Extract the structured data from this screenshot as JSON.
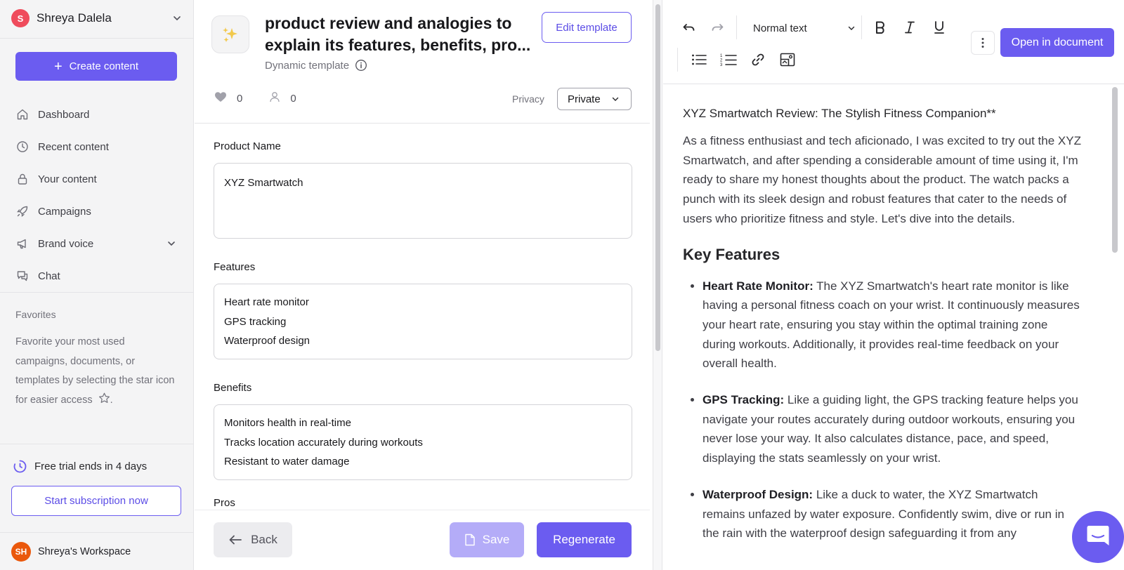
{
  "sidebar": {
    "user": {
      "initial": "S",
      "name": "Shreya Dalela"
    },
    "create_label": "Create content",
    "nav": [
      {
        "label": "Dashboard",
        "icon": "home-icon"
      },
      {
        "label": "Recent content",
        "icon": "clock-icon"
      },
      {
        "label": "Your content",
        "icon": "lock-icon"
      },
      {
        "label": "Campaigns",
        "icon": "rocket-icon"
      },
      {
        "label": "Brand voice",
        "icon": "megaphone-icon"
      },
      {
        "label": "Chat",
        "icon": "chat-icon"
      }
    ],
    "favorites_title": "Favorites",
    "favorites_desc": "Favorite your most used campaigns, documents, or templates by selecting the star icon for easier access",
    "favorites_desc_end": ".",
    "trial_text": "Free trial ends in 4 days",
    "subscribe_label": "Start subscription now",
    "workspace": {
      "initials": "SH",
      "name": "Shreya's Workspace"
    }
  },
  "template": {
    "title": "product review and analogies to explain its features, benefits, pro...",
    "subtitle": "Dynamic template",
    "edit_label": "Edit template",
    "likes": "0",
    "users": "0",
    "privacy_label": "Privacy",
    "privacy_value": "Private"
  },
  "form": {
    "product_name_label": "Product Name",
    "product_name_value": "XYZ Smartwatch",
    "features_label": "Features",
    "features_lines": [
      "Heart rate monitor",
      "GPS tracking",
      "Waterproof design"
    ],
    "benefits_label": "Benefits",
    "benefits_lines": [
      "Monitors health in real-time",
      "Tracks location accurately during workouts",
      "Resistant to water damage"
    ],
    "pros_label": "Pros"
  },
  "footer": {
    "back_label": "Back",
    "save_label": "Save",
    "regenerate_label": "Regenerate"
  },
  "editor": {
    "text_style": "Normal text",
    "open_label": "Open in document",
    "doc_title": "XYZ Smartwatch Review: The Stylish Fitness Companion**",
    "intro": "As a fitness enthusiast and tech aficionado, I was excited to try out the XYZ Smartwatch, and after spending a considerable amount of time using it, I'm ready to share my honest thoughts about the product. The watch packs a punch with its sleek design and robust features that cater to the needs of users who prioritize fitness and style. Let's dive into the details.",
    "section_heading": "Key Features",
    "features": [
      {
        "name": "Heart Rate Monitor:",
        "text": " The XYZ Smartwatch's heart rate monitor is like having a personal fitness coach on your wrist. It continuously measures your heart rate, ensuring you stay within the optimal training zone during workouts. Additionally, it provides real-time feedback on your overall health."
      },
      {
        "name": "GPS Tracking:",
        "text": " Like a guiding light, the GPS tracking feature helps you navigate your routes accurately during outdoor workouts, ensuring you never lose your way. It also calculates distance, pace, and speed, displaying the stats seamlessly on your wrist."
      },
      {
        "name": "Waterproof Design:",
        "text": " Like a duck to water, the XYZ Smartwatch remains unfazed by water exposure. Confidently swim, dive or run in the rain with the waterproof design safeguarding it from any"
      }
    ]
  },
  "colors": {
    "accent": "#6b5cf0",
    "accent_disabled": "#b4acf8",
    "user_avatar": "#ef4b5c",
    "workspace_avatar": "#ea580c"
  }
}
